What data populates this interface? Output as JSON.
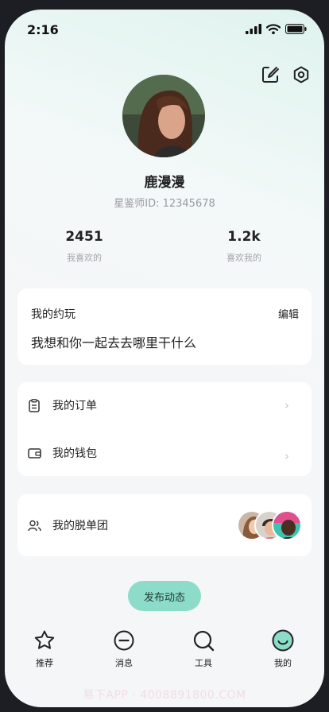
{
  "status": {
    "time": "2:16"
  },
  "profile": {
    "nickname": "鹿漫漫",
    "id_text": "星鉴师ID: 12345678"
  },
  "stats": [
    {
      "value": "2451",
      "label": "我喜欢的"
    },
    {
      "value": "1.2k",
      "label": "喜欢我的"
    }
  ],
  "play_card": {
    "title": "我的约玩",
    "edit_label": "编辑",
    "content": "我想和你一起去去哪里干什么"
  },
  "menu": {
    "orders": "我的订单",
    "wallet": "我的钱包",
    "group": "我的脱单团"
  },
  "publish_label": "发布动态",
  "tabs": [
    {
      "label": "推荐",
      "icon": "star-icon"
    },
    {
      "label": "消息",
      "icon": "message-icon"
    },
    {
      "label": "工具",
      "icon": "search-icon"
    },
    {
      "label": "我的",
      "icon": "smile-icon"
    }
  ],
  "watermark": "易下APP · 4008891800.COM",
  "colors": {
    "accent": "#8cdcc9",
    "background": "#f5f6f8",
    "card": "#ffffff"
  }
}
